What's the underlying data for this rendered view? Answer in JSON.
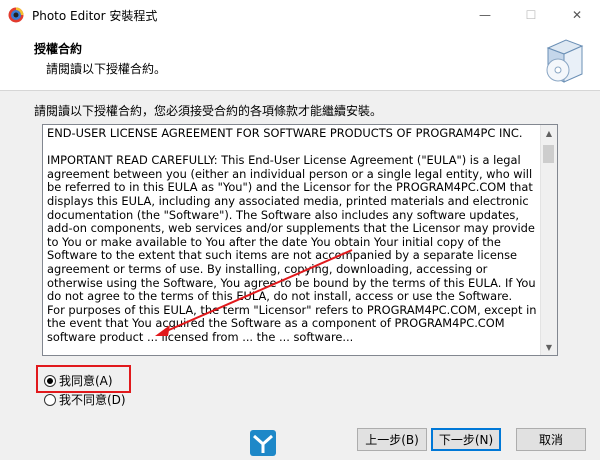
{
  "window": {
    "title": "Photo Editor 安裝程式",
    "minimize_glyph": "—",
    "maximize_glyph": "☐",
    "close_glyph": "✕"
  },
  "header": {
    "title": "授權合約",
    "subtitle": "請閱讀以下授權合約。"
  },
  "instruction": "請閱讀以下授權合約，您必須接受合約的各項條款才能繼續安裝。",
  "eula": {
    "text": "END-USER LICENSE AGREEMENT FOR SOFTWARE PRODUCTS OF PROGRAM4PC INC.\n\nIMPORTANT READ CAREFULLY: This End-User License Agreement (\"EULA\") is a legal agreement between you (either an individual person or a single legal entity, who will be referred to in this EULA as \"You\") and the Licensor for the PROGRAM4PC.COM that displays this EULA, including any associated media, printed materials and electronic documentation (the \"Software\"). The Software also includes any software updates, add-on components, web services and/or supplements that the Licensor may provide to You or make available to You after the date You obtain Your initial copy of the Software to the extent that such items are not accompanied by a separate license agreement or terms of use. By installing, copying, downloading, accessing or otherwise using the Software, You agree to be bound by the terms of this EULA. If You do not agree to the terms of this EULA, do not install, access or use the Software.\nFor purposes of this EULA, the term \"Licensor\" refers to PROGRAM4PC.COM, except in the event that You acquired the Software as a component of PROGRAM4PC.COM software product ... licensed from ... the ... software..."
  },
  "options": {
    "agree": "我同意(A)",
    "disagree": "我不同意(D)",
    "selected": "agree"
  },
  "buttons": {
    "back": "上一步(B)",
    "next": "下一步(N)",
    "cancel": "取消"
  },
  "colors": {
    "highlight_box": "#e1191c",
    "arrow": "#e1191c",
    "default_button_border": "#0078d7"
  }
}
